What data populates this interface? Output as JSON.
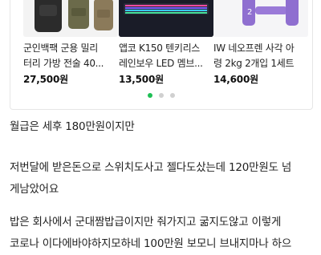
{
  "products": [
    {
      "title_line1": "군인백팩 군용 밀리",
      "title_line2": "터리 가방 전술 40...",
      "price": "27,500원",
      "image_icon": "military-backpack"
    },
    {
      "title_line1": "앱코 K150 텐키리스",
      "title_line2": "레인보우 LED 멤브...",
      "price": "13,500원",
      "image_icon": "keyboard"
    },
    {
      "title_line1": "IW 네오프렌 사각 아",
      "title_line2": "령 2kg 2개입 1세트",
      "price": "14,600원",
      "image_icon": "dumbbell"
    }
  ],
  "pager": {
    "count": 3,
    "active": 0,
    "active_color": "#1fbf55"
  },
  "body_text": {
    "p1": "월급은 세후 180만원이지만",
    "p2_line1": "저번달에 받은돈으로 스위치도사고 젤다도샀는데 120만원도 넘",
    "p2_line2": "게남았어요",
    "p3_line1": "밥은 회사에서 군대짬밥급이지만 줘가지고 굶지도않고 이렇게",
    "p3_line2": "코로나 이다에바야하지모하네 100만원 보모니 브내지마나 하으"
  }
}
